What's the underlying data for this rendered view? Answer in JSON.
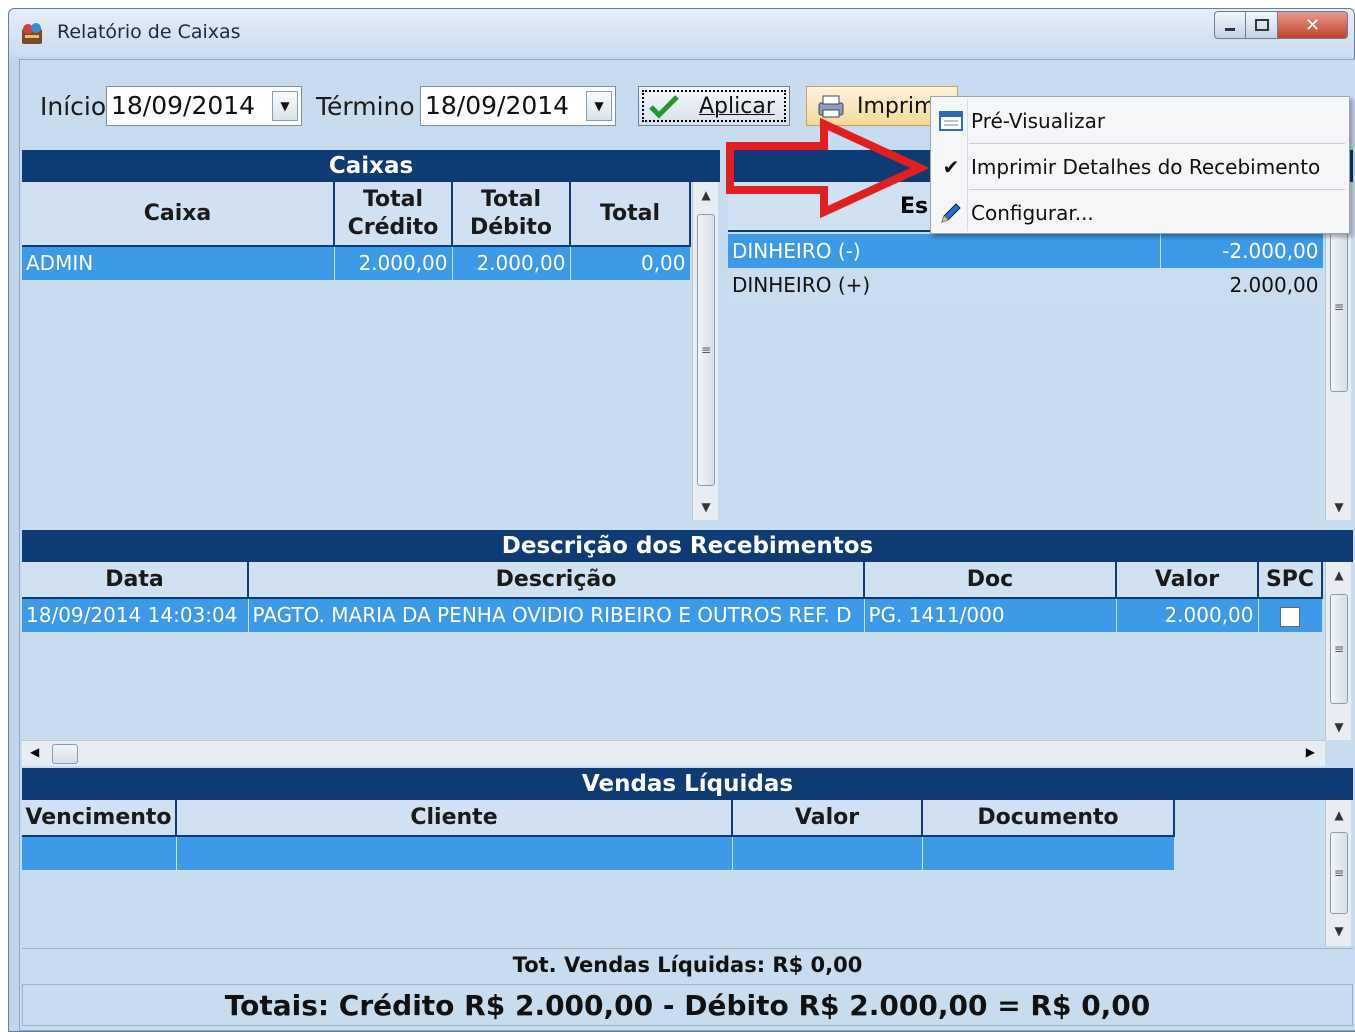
{
  "window": {
    "title": "Relatório de Caixas"
  },
  "toolbar": {
    "inicio_label": "Início",
    "inicio_value": "18/09/2014",
    "termino_label": "Término",
    "termino_value": "18/09/2014",
    "aplicar_label": "Aplicar",
    "imprimir_label": "Imprim"
  },
  "caixas": {
    "title": "Caixas",
    "headers": [
      "Caixa",
      "Total Crédito",
      "Total Débito",
      "Total"
    ],
    "rows": [
      {
        "caixa": "ADMIN",
        "credito": "2.000,00",
        "debito": "2.000,00",
        "total": "0,00"
      }
    ]
  },
  "especie": {
    "header_partial": "Es",
    "rows": [
      {
        "nome": "DINHEIRO (-)",
        "valor": "-2.000,00"
      },
      {
        "nome": "DINHEIRO (+)",
        "valor": "2.000,00"
      }
    ]
  },
  "recebimentos": {
    "title": "Descrição dos Recebimentos",
    "headers": [
      "Data",
      "Descrição",
      "Doc",
      "Valor",
      "SPC"
    ],
    "rows": [
      {
        "data": "18/09/2014 14:03:04",
        "descricao": "PAGTO. MARIA DA PENHA OVIDIO RIBEIRO E OUTROS REF. D",
        "doc": "PG. 1411/000",
        "valor": "2.000,00",
        "spc": false
      }
    ]
  },
  "vendas": {
    "title": "Vendas Líquidas",
    "headers": [
      "Vencimento",
      "Cliente",
      "Valor",
      "Documento"
    ],
    "total_line": "Tot. Vendas Líquidas: R$ 0,00"
  },
  "totais_line": "Totais: Crédito R$ 2.000,00 - Débito R$ 2.000,00 = R$ 0,00",
  "menu": {
    "items": [
      "Pré-Visualizar",
      "Imprimir Detalhes do Recebimento",
      "Configurar..."
    ],
    "checked_item": "Imprimir Detalhes do Recebimento"
  },
  "colors": {
    "header_bg": "#0e3b73",
    "selection": "#3d9ae8",
    "panel_bg": "#c8dcf0",
    "arrow": "#e02020"
  },
  "icons": [
    "app-icon",
    "check-icon",
    "printer-icon",
    "preview-icon",
    "checkmark-icon",
    "pencil-icon",
    "red-arrow"
  ]
}
